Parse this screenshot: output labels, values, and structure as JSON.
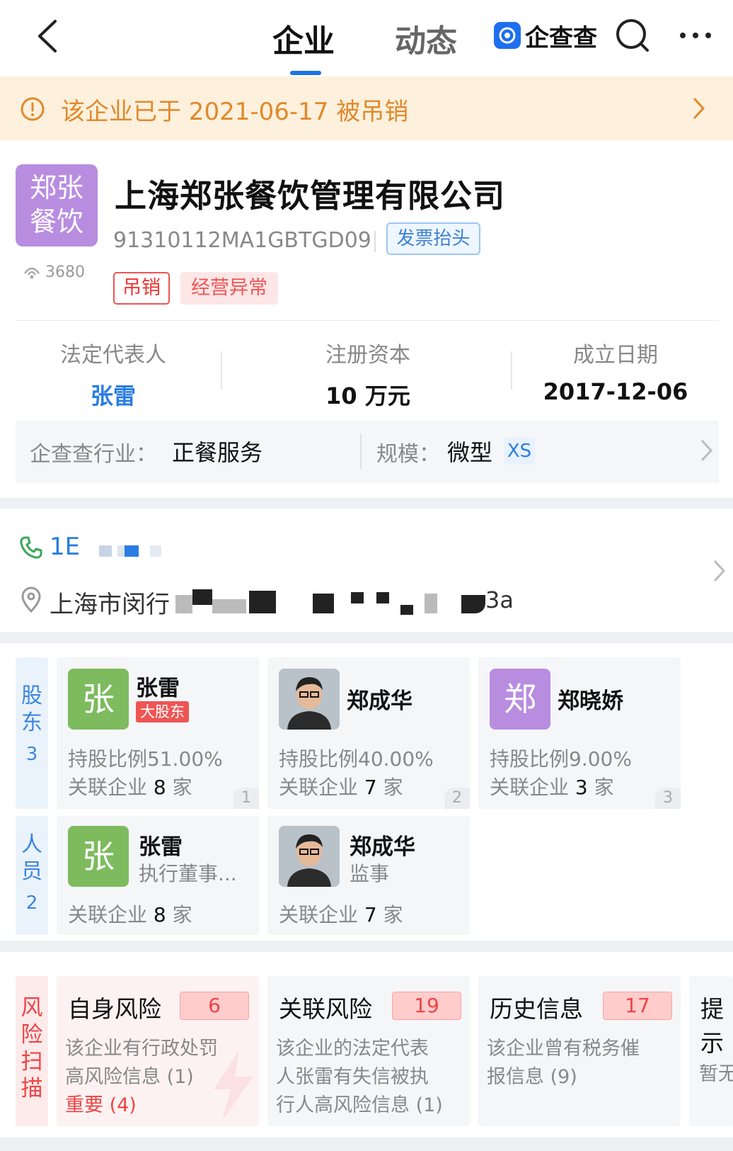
{
  "header": {
    "tabs": [
      {
        "label": "企业"
      },
      {
        "label": "动态"
      }
    ],
    "brand": "企查查"
  },
  "banner": {
    "text": "该企业已于 2021-06-17 被吊销"
  },
  "company": {
    "logo_line1": "郑张",
    "logo_line2": "餐饮",
    "name": "上海郑张餐饮管理有限公司",
    "credit_code": "91310112MA1GBTGD09",
    "invoice_button": "发票抬头",
    "views": "3680",
    "tags": [
      "吊销",
      "经营异常"
    ]
  },
  "key_info": {
    "legal_rep_label": "法定代表人",
    "legal_rep_value": "张雷",
    "capital_label": "注册资本",
    "capital_value": "10 万元",
    "founded_label": "成立日期",
    "founded_value": "2017-12-06"
  },
  "industry": {
    "label": "企查查行业：",
    "value": "正餐服务",
    "scale_label": "规模：",
    "scale_value": "微型",
    "scale_badge": "XS"
  },
  "contact": {
    "phone_visible": "1E",
    "address_visible": "上海市闵行",
    "address_tail": "3a"
  },
  "shareholders": {
    "label": "股东",
    "count": "3",
    "items": [
      {
        "avatar": "张",
        "name": "张雷",
        "badge": "大股东",
        "ratio": "持股比例51.00%",
        "related_prefix": "关联企业",
        "related_count": "8",
        "related_suffix": "家",
        "index": "1"
      },
      {
        "avatar": "",
        "name": "郑成华",
        "badge": "",
        "ratio": "持股比例40.00%",
        "related_prefix": "关联企业",
        "related_count": "7",
        "related_suffix": "家",
        "index": "2"
      },
      {
        "avatar": "郑",
        "name": "郑晓娇",
        "badge": "",
        "ratio": "持股比例9.00%",
        "related_prefix": "关联企业",
        "related_count": "3",
        "related_suffix": "家",
        "index": "3"
      }
    ]
  },
  "staff": {
    "label": "人员",
    "count": "2",
    "items": [
      {
        "avatar": "张",
        "name": "张雷",
        "role": "执行董事...",
        "related_prefix": "关联企业",
        "related_count": "8",
        "related_suffix": "家"
      },
      {
        "avatar": "",
        "name": "郑成华",
        "role": "监事",
        "related_prefix": "关联企业",
        "related_count": "7",
        "related_suffix": "家"
      }
    ]
  },
  "risk": {
    "label": "风险扫描",
    "cards": [
      {
        "title": "自身风险",
        "count": "6",
        "lines": [
          "该企业有行政处罚",
          "高风险信息 (1)"
        ],
        "highlight": "重要 (4)"
      },
      {
        "title": "关联风险",
        "count": "19",
        "lines": [
          "该企业的法定代表",
          "人张雷有失信被执",
          "行人高风险信息 (1)"
        ],
        "highlight": ""
      },
      {
        "title": "历史信息",
        "count": "17",
        "lines": [
          "该企业曾有税务催",
          "报信息 (9)"
        ],
        "highlight": ""
      },
      {
        "title": "提示",
        "count": "",
        "lines": [
          "暂无"
        ],
        "highlight": ""
      }
    ]
  },
  "colors": {
    "accent": "#1a73e8",
    "warning_bg": "#fdf0dc",
    "warning_text": "#e0892b",
    "risk_red": "#e44"
  }
}
